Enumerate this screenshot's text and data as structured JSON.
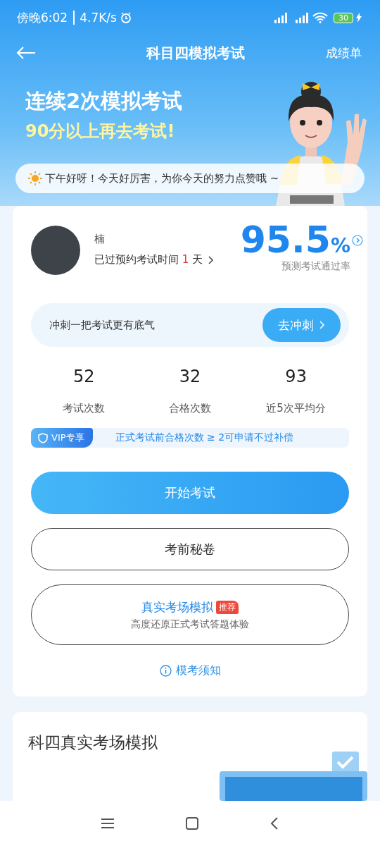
{
  "status_bar": {
    "time": "傍晚6:02",
    "speed": "4.7K/s",
    "battery": "30"
  },
  "header": {
    "title": "科目四模拟考试",
    "action": "成绩单"
  },
  "banner": {
    "line1": "连续2次模拟考试",
    "line2": "90分以上再去考试!",
    "greeting": "下午好呀！今天好厉害，为你今天的努力点赞哦 ~"
  },
  "profile": {
    "name": "楠",
    "notice_prefix": "已过预约考试时间",
    "notice_days": "1",
    "notice_unit": "天",
    "rate": "95.5",
    "rate_unit": "%",
    "rate_label": "预测考试通过率"
  },
  "sprint": {
    "text": "冲刺一把考试更有底气",
    "button": "去冲刺"
  },
  "stats": [
    {
      "value": "52",
      "label": "考试次数"
    },
    {
      "value": "32",
      "label": "合格次数"
    },
    {
      "value": "93",
      "label": "近5次平均分"
    }
  ],
  "vip": {
    "badge": "VIP专享",
    "text": "正式考试前合格次数 ≥ 2可申请不过补偿"
  },
  "actions": [
    {
      "kind": "primary",
      "label": "开始考试"
    },
    {
      "kind": "outline",
      "label": "考前秘卷"
    },
    {
      "kind": "detail",
      "label": "真实考场模拟",
      "tag": "推荐",
      "subtitle": "高度还原正式考试答题体验"
    }
  ],
  "notice_link": "模考须知",
  "section": {
    "title": "科四真实考场模拟"
  }
}
